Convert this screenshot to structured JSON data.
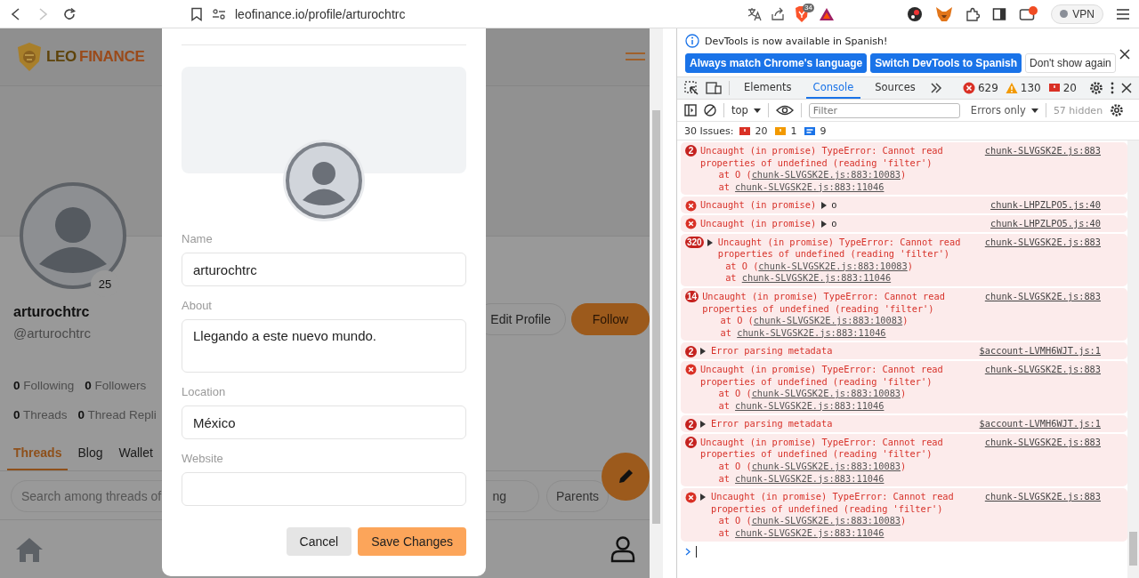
{
  "browser": {
    "back_disabled": false,
    "forward_disabled": true,
    "url": "leofinance.io/profile/arturochtrc",
    "shield_badge": "34",
    "vpn_label": "VPN"
  },
  "page": {
    "logo": [
      "LEO",
      "FINANCE"
    ],
    "profile": {
      "name": "arturochtrc",
      "handle": "@arturochtrc",
      "post_badge": "25",
      "buttons": [
        {
          "label": "Edit Profile",
          "kind": "outline"
        },
        {
          "label": "Follow",
          "kind": "primary"
        }
      ]
    },
    "stats": [
      [
        "**0** Following",
        "**0** Followers"
      ],
      [
        "**0** Threads",
        "**0** Thread Repli"
      ]
    ],
    "tabs": [
      {
        "label": "Threads",
        "selected": true
      },
      {
        "label": "Blog",
        "selected": false
      },
      {
        "label": "Wallet",
        "selected": false
      }
    ],
    "search": {
      "placeholder": "Search among threads of"
    },
    "filter_chips": [
      "ng",
      "Parents"
    ]
  },
  "modal": {
    "fields": [
      {
        "label": "Name",
        "kind": "input",
        "value": "arturochtrc"
      },
      {
        "label": "About",
        "kind": "textarea",
        "value": "Llegando a este nuevo mundo."
      },
      {
        "label": "Location",
        "kind": "input",
        "value": "México"
      },
      {
        "label": "Website",
        "kind": "input"
      }
    ],
    "buttons": [
      {
        "label": "Cancel",
        "kind": "secondary"
      },
      {
        "label": "Save Changes",
        "kind": "primary"
      }
    ]
  },
  "devtools": {
    "infobar": {
      "message": "DevTools is now available in Spanish!",
      "buttons": [
        {
          "label": "Always match Chrome's language",
          "kind": "primary"
        },
        {
          "label": "Switch DevTools to Spanish",
          "kind": "primary"
        },
        {
          "label": "Don't show again",
          "kind": "secondary"
        }
      ]
    },
    "tabs": [
      {
        "label": "Elements",
        "selected": false
      },
      {
        "label": "Console",
        "selected": true
      },
      {
        "label": "Sources",
        "selected": false
      }
    ],
    "counters": [
      {
        "kind": "error",
        "count": "629"
      },
      {
        "kind": "warning",
        "count": "130"
      },
      {
        "kind": "issue",
        "count": "20"
      }
    ],
    "toolbar": {
      "context": "top",
      "filter_placeholder": "Filter",
      "level": "Errors only",
      "hidden": "57 hidden"
    },
    "issues": {
      "label": "30 Issues:",
      "counts": [
        {
          "kind": "error",
          "count": "20"
        },
        {
          "kind": "warning",
          "count": "1"
        },
        {
          "kind": "info",
          "count": "9"
        }
      ]
    },
    "messages": [
      {
        "kind": "error",
        "count": "2",
        "expandable": false,
        "text": "Uncaught (in promise) TypeError: Cannot read properties of undefined (reading 'filter')",
        "stack": [
          {
            "prefix": "at O (",
            "link": "chunk-SLVGSK2E.js:883:10083",
            "suffix": ")"
          },
          {
            "prefix": "at ",
            "link": "chunk-SLVGSK2E.js:883:11046"
          }
        ],
        "source": "chunk-SLVGSK2E.js:883"
      },
      {
        "kind": "object",
        "text": "Uncaught (in promise)",
        "object": "o",
        "expanded": false,
        "source": "chunk-LHPZLPO5.js:40"
      },
      {
        "kind": "object",
        "text": "Uncaught (in promise)",
        "object": "o",
        "expanded": false,
        "source": "chunk-LHPZLPO5.js:40"
      },
      {
        "kind": "error",
        "count": "320",
        "expandable": true,
        "expanded": false,
        "text": "Uncaught (in promise) TypeError: Cannot read properties of undefined (reading 'filter')",
        "stack": [
          {
            "prefix": "at O (",
            "link": "chunk-SLVGSK2E.js:883:10083",
            "suffix": ")"
          },
          {
            "prefix": "at ",
            "link": "chunk-SLVGSK2E.js:883:11046"
          }
        ],
        "source": "chunk-SLVGSK2E.js:883"
      },
      {
        "kind": "error",
        "count": "14",
        "expandable": false,
        "text": "Uncaught (in promise) TypeError: Cannot read properties of undefined (reading 'filter')",
        "stack": [
          {
            "prefix": "at O (",
            "link": "chunk-SLVGSK2E.js:883:10083",
            "suffix": ")"
          },
          {
            "prefix": "at ",
            "link": "chunk-SLVGSK2E.js:883:11046"
          }
        ],
        "source": "chunk-SLVGSK2E.js:883"
      },
      {
        "kind": "error",
        "count": "2",
        "expandable": true,
        "expanded": false,
        "text": "Error parsing metadata",
        "source": "$account-LVMH6WJT.js:1"
      },
      {
        "kind": "error",
        "expandable": false,
        "text": "Uncaught (in promise) TypeError: Cannot read properties of undefined (reading 'filter')",
        "stack": [
          {
            "prefix": "at O (",
            "link": "chunk-SLVGSK2E.js:883:10083",
            "suffix": ")"
          },
          {
            "prefix": "at ",
            "link": "chunk-SLVGSK2E.js:883:11046"
          }
        ],
        "source": "chunk-SLVGSK2E.js:883"
      },
      {
        "kind": "error",
        "count": "2",
        "expandable": true,
        "expanded": false,
        "text": "Error parsing metadata",
        "source": "$account-LVMH6WJT.js:1"
      },
      {
        "kind": "error",
        "count": "2",
        "expandable": false,
        "text": "Uncaught (in promise) TypeError: Cannot read properties of undefined (reading 'filter')",
        "stack": [
          {
            "prefix": "at O (",
            "link": "chunk-SLVGSK2E.js:883:10083",
            "suffix": ")"
          },
          {
            "prefix": "at ",
            "link": "chunk-SLVGSK2E.js:883:11046"
          }
        ],
        "source": "chunk-SLVGSK2E.js:883"
      },
      {
        "kind": "error",
        "expandable": true,
        "expanded": false,
        "text": "Uncaught (in promise) TypeError: Cannot read properties of undefined (reading 'filter')",
        "stack": [
          {
            "prefix": "at O (",
            "link": "chunk-SLVGSK2E.js:883:10083",
            "suffix": ")"
          },
          {
            "prefix": "at ",
            "link": "chunk-SLVGSK2E.js:883:11046"
          }
        ],
        "source": "chunk-SLVGSK2E.js:883"
      }
    ]
  }
}
